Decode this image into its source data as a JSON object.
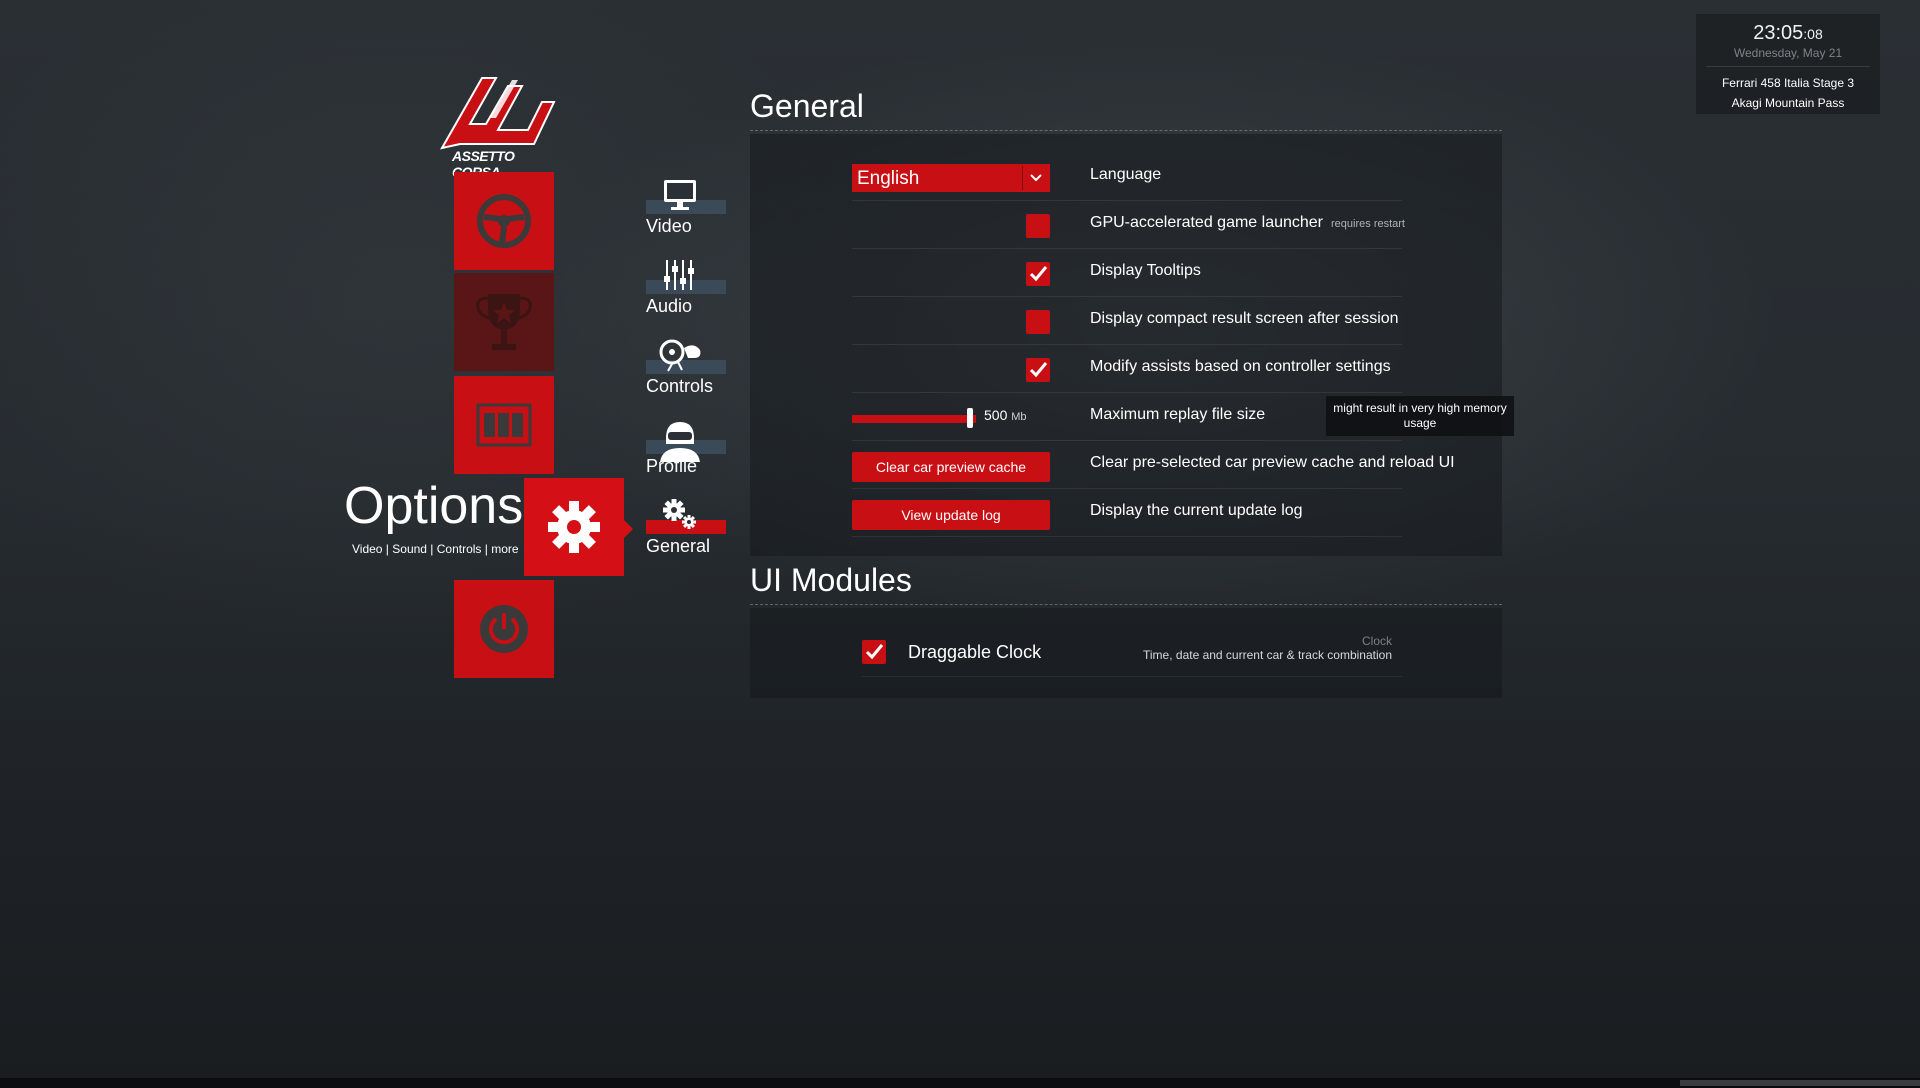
{
  "clock": {
    "time": "23:05",
    "seconds": ":08",
    "date": "Wednesday, May 21",
    "car": "Ferrari 458 Italia Stage 3",
    "track": "Akagi Mountain Pass"
  },
  "logo": {
    "text": "ASSETTO CORSA"
  },
  "main_nav": {
    "items": [
      {
        "icon": "steering-wheel-icon",
        "active": false
      },
      {
        "icon": "trophy-icon",
        "active": false
      },
      {
        "icon": "film-strip-icon",
        "active": false
      },
      {
        "icon": "gear-icon",
        "active": true
      },
      {
        "icon": "power-icon",
        "active": false
      }
    ],
    "active_title": "Options",
    "active_subtitle": "Video | Sound | Controls | more"
  },
  "sub_nav": {
    "items": [
      {
        "label": "Video",
        "icon": "monitor-icon"
      },
      {
        "label": "Audio",
        "icon": "mixer-sliders-icon"
      },
      {
        "label": "Controls",
        "icon": "controller-icon"
      },
      {
        "label": "Profile",
        "icon": "driver-helmet-icon"
      },
      {
        "label": "General",
        "icon": "gears-icon",
        "active": true
      }
    ]
  },
  "general": {
    "title": "General",
    "language": {
      "value": "English",
      "label": "Language"
    },
    "gpu_launcher": {
      "label": "GPU-accelerated game launcher",
      "note": "requires restart",
      "checked": false
    },
    "tooltips": {
      "label": "Display Tooltips",
      "checked": true
    },
    "compact_result": {
      "label": "Display compact result screen after session",
      "checked": false
    },
    "modify_assists": {
      "label": "Modify assists based on controller settings",
      "checked": true
    },
    "replay": {
      "value": "500",
      "unit": "Mb",
      "level": 0.95,
      "label": "Maximum replay file size"
    },
    "tooltip_text": "might result in very high memory usage",
    "clear_cache": {
      "button": "Clear car preview cache",
      "label": "Clear pre-selected car preview cache and reload UI"
    },
    "update_log": {
      "button": "View update log",
      "label": "Display the current update log"
    }
  },
  "ui_modules": {
    "title": "UI Modules",
    "items": [
      {
        "name": "Draggable Clock",
        "checked": true,
        "module_title": "Clock",
        "description": "Time, date and current car & track combination"
      }
    ]
  },
  "colors": {
    "accent": "#c80f14",
    "dim_tile": "#5a1517",
    "submenu_bar": "#3b4a58"
  }
}
